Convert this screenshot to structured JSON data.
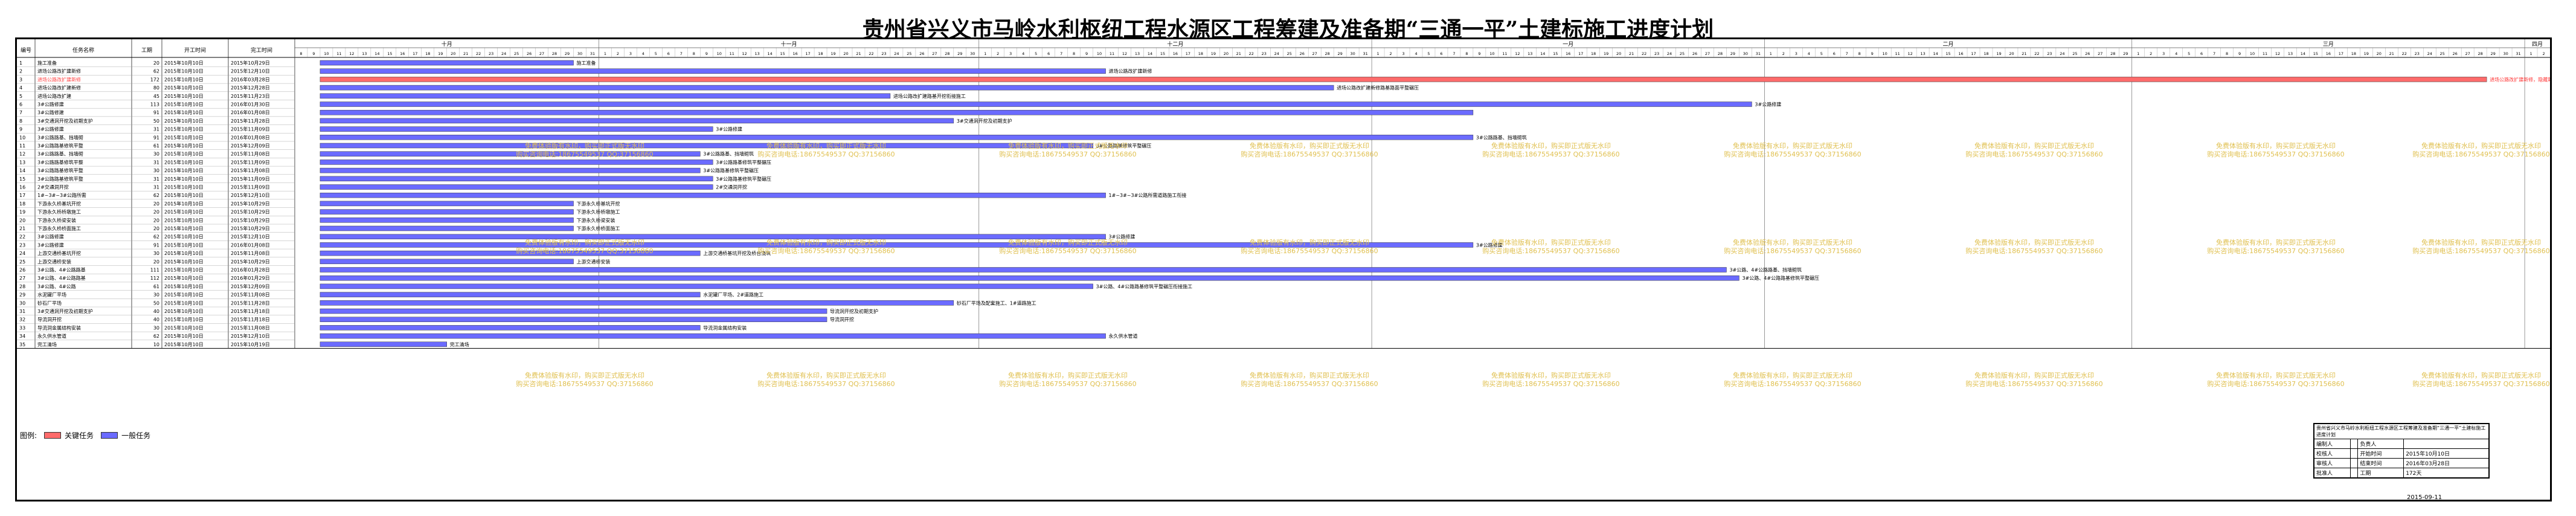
{
  "title": "贵州省兴义市马岭水利枢纽工程水源区工程筹建及准备期“三通一平”土建标施工进度计划",
  "chart_data": {
    "type": "gantt",
    "columns": [
      "编号",
      "任务名称",
      "工期",
      "开工时间",
      "完工时间"
    ],
    "months": [
      "十月",
      "十一月",
      "十二月",
      "一月",
      "二月",
      "三月",
      "四月"
    ],
    "timeline_start": "2015-10-08",
    "timeline_end": "2016-04-02",
    "tasks": [
      {
        "id": "1",
        "name": "施工准备",
        "dur": "20",
        "start": "2015年10月10日",
        "finish": "2015年10月29日",
        "s": "2015-10-10",
        "e": "2015-10-29",
        "label": "施工准备",
        "critical": false
      },
      {
        "id": "2",
        "name": "进场公路改扩建新修",
        "dur": "62",
        "start": "2015年10月10日",
        "finish": "2015年12月10日",
        "s": "2015-10-10",
        "e": "2015-12-10",
        "label": "进场公路改扩建新修",
        "critical": false
      },
      {
        "id": "3",
        "name": "进场公路改扩建新修",
        "dur": "172",
        "start": "2015年10月10日",
        "finish": "2016年03月28日",
        "s": "2015-10-10",
        "e": "2016-03-28",
        "label": "进场公路改扩建新修，隐藏新建",
        "critical": true
      },
      {
        "id": "4",
        "name": "进场公路改扩建新修",
        "dur": "80",
        "start": "2015年10月10日",
        "finish": "2015年12月28日",
        "s": "2015-10-10",
        "e": "2015-12-28",
        "label": "进场公路改扩建新修路基路面平整碾压",
        "critical": false
      },
      {
        "id": "5",
        "name": "进场公路改扩建",
        "dur": "45",
        "start": "2015年10月10日",
        "finish": "2015年11月23日",
        "s": "2015-10-10",
        "e": "2015-11-23",
        "label": "进场公路改扩建路基开挖衔接施工",
        "critical": false
      },
      {
        "id": "6",
        "name": "3#公路修建",
        "dur": "113",
        "start": "2015年10月10日",
        "finish": "2016年01月30日",
        "s": "2015-10-10",
        "e": "2016-01-30",
        "label": "3#公路修建",
        "critical": false
      },
      {
        "id": "7",
        "name": "3#公路修建",
        "dur": "91",
        "start": "2015年10月10日",
        "finish": "2016年01月08日",
        "s": "2015-10-10",
        "e": "2016-01-08",
        "label": "",
        "critical": false
      },
      {
        "id": "8",
        "name": "3#交通洞开挖及初期支护",
        "dur": "50",
        "start": "2015年10月10日",
        "finish": "2015年11月28日",
        "s": "2015-10-10",
        "e": "2015-11-28",
        "label": "3#交通洞开挖及初期支护",
        "critical": false
      },
      {
        "id": "9",
        "name": "3#公路修建",
        "dur": "31",
        "start": "2015年10月10日",
        "finish": "2015年11月09日",
        "s": "2015-10-10",
        "e": "2015-11-09",
        "label": "3#公路修建",
        "critical": false
      },
      {
        "id": "10",
        "name": "3#公路路基、挡墙砌",
        "dur": "91",
        "start": "2015年10月10日",
        "finish": "2016年01月08日",
        "s": "2015-10-10",
        "e": "2016-01-08",
        "label": "3#公路路基、挡墙砌筑",
        "critical": false
      },
      {
        "id": "11",
        "name": "3#公路路基修筑平整",
        "dur": "61",
        "start": "2015年10月10日",
        "finish": "2015年12月09日",
        "s": "2015-10-10",
        "e": "2015-12-09",
        "label": "3#公路路基修筑平整碾压",
        "critical": false
      },
      {
        "id": "12",
        "name": "3#公路路基、挡墙砌",
        "dur": "30",
        "start": "2015年10月10日",
        "finish": "2015年11月08日",
        "s": "2015-10-10",
        "e": "2015-11-08",
        "label": "3#公路路基、挡墙砌筑",
        "critical": false
      },
      {
        "id": "13",
        "name": "3#公路路基修筑平整",
        "dur": "31",
        "start": "2015年10月10日",
        "finish": "2015年11月09日",
        "s": "2015-10-10",
        "e": "2015-11-09",
        "label": "3#公路路基修筑平整碾压",
        "critical": false
      },
      {
        "id": "14",
        "name": "3#公路路基修筑平整",
        "dur": "30",
        "start": "2015年10月10日",
        "finish": "2015年11月08日",
        "s": "2015-10-10",
        "e": "2015-11-08",
        "label": "3#公路路基修筑平整碾压",
        "critical": false
      },
      {
        "id": "15",
        "name": "3#公路路基修筑平整",
        "dur": "31",
        "start": "2015年10月10日",
        "finish": "2015年11月09日",
        "s": "2015-10-10",
        "e": "2015-11-09",
        "label": "3#公路路基修筑平整碾压",
        "critical": false
      },
      {
        "id": "16",
        "name": "2#交通洞开挖",
        "dur": "31",
        "start": "2015年10月10日",
        "finish": "2015年11月09日",
        "s": "2015-10-10",
        "e": "2015-11-09",
        "label": "2#交通洞开挖",
        "critical": false
      },
      {
        "id": "17",
        "name": "1#~3#~3#公路所需",
        "dur": "62",
        "start": "2015年10月10日",
        "finish": "2015年12月10日",
        "s": "2015-10-10",
        "e": "2015-12-10",
        "label": "1#~3#~3#公路所需道路施工衔接",
        "critical": false
      },
      {
        "id": "18",
        "name": "下游永久桥基坑开挖",
        "dur": "20",
        "start": "2015年10月10日",
        "finish": "2015年10月29日",
        "s": "2015-10-10",
        "e": "2015-10-29",
        "label": "下游永久桥基坑开挖",
        "critical": false
      },
      {
        "id": "19",
        "name": "下游永久桥桥墩施工",
        "dur": "20",
        "start": "2015年10月10日",
        "finish": "2015年10月29日",
        "s": "2015-10-10",
        "e": "2015-10-29",
        "label": "下游永久桥桥墩施工",
        "critical": false
      },
      {
        "id": "20",
        "name": "下游永久桥梁安装",
        "dur": "20",
        "start": "2015年10月10日",
        "finish": "2015年10月29日",
        "s": "2015-10-10",
        "e": "2015-10-29",
        "label": "下游永久桥梁安装",
        "critical": false
      },
      {
        "id": "21",
        "name": "下游永久桥桥面施工",
        "dur": "20",
        "start": "2015年10月10日",
        "finish": "2015年10月29日",
        "s": "2015-10-10",
        "e": "2015-10-29",
        "label": "下游永久桥桥面施工",
        "critical": false
      },
      {
        "id": "22",
        "name": "3#公路修建",
        "dur": "62",
        "start": "2015年10月10日",
        "finish": "2015年12月10日",
        "s": "2015-10-10",
        "e": "2015-12-10",
        "label": "3#公路修建",
        "critical": false
      },
      {
        "id": "23",
        "name": "3#公路修建",
        "dur": "91",
        "start": "2015年10月10日",
        "finish": "2016年01月08日",
        "s": "2015-10-10",
        "e": "2016-01-08",
        "label": "3#公路修建",
        "critical": false
      },
      {
        "id": "24",
        "name": "上游交通桥基坑开挖",
        "dur": "30",
        "start": "2015年10月10日",
        "finish": "2015年11月08日",
        "s": "2015-10-10",
        "e": "2015-11-08",
        "label": "上游交通桥基坑开挖及桥台浇筑",
        "critical": false
      },
      {
        "id": "25",
        "name": "上游交通桥安装",
        "dur": "20",
        "start": "2015年10月10日",
        "finish": "2015年10月29日",
        "s": "2015-10-10",
        "e": "2015-10-29",
        "label": "上游交通桥安装",
        "critical": false
      },
      {
        "id": "26",
        "name": "3#公路、4#公路路基",
        "dur": "111",
        "start": "2015年10月10日",
        "finish": "2016年01月28日",
        "s": "2015-10-10",
        "e": "2016-01-28",
        "label": "3#公路、4#公路路基、挡墙砌筑",
        "critical": false
      },
      {
        "id": "27",
        "name": "3#公路、4#公路路基",
        "dur": "112",
        "start": "2015年10月10日",
        "finish": "2016年01月29日",
        "s": "2015-10-10",
        "e": "2016-01-29",
        "label": "3#公路、4#公路路基修筑平整碾压",
        "critical": false
      },
      {
        "id": "28",
        "name": "3#公路、4#公路",
        "dur": "61",
        "start": "2015年10月10日",
        "finish": "2015年12月09日",
        "s": "2015-10-10",
        "e": "2015-12-09",
        "label": "3#公路、4#公路路基修筑平整碾压衔接施工",
        "critical": false
      },
      {
        "id": "29",
        "name": "水泥罐厂平场",
        "dur": "30",
        "start": "2015年10月10日",
        "finish": "2015年11月08日",
        "s": "2015-10-10",
        "e": "2015-11-08",
        "label": "水泥罐厂平场、2#道路施工",
        "critical": false
      },
      {
        "id": "30",
        "name": "砂石厂平场",
        "dur": "50",
        "start": "2015年10月10日",
        "finish": "2015年11月28日",
        "s": "2015-10-10",
        "e": "2015-11-28",
        "label": "砂石厂平场及配套施工、1#道路施工",
        "critical": false
      },
      {
        "id": "31",
        "name": "3#交通洞开挖及初期支护",
        "dur": "40",
        "start": "2015年10月10日",
        "finish": "2015年11月18日",
        "s": "2015-10-10",
        "e": "2015-11-18",
        "label": "导流洞开挖及初期支护",
        "critical": false
      },
      {
        "id": "32",
        "name": "导流洞开挖",
        "dur": "40",
        "start": "2015年10月10日",
        "finish": "2015年11月18日",
        "s": "2015-10-10",
        "e": "2015-11-18",
        "label": "导流洞开挖",
        "critical": false
      },
      {
        "id": "33",
        "name": "导流洞金属结构安装",
        "dur": "30",
        "start": "2015年10月10日",
        "finish": "2015年11月08日",
        "s": "2015-10-10",
        "e": "2015-11-08",
        "label": "导流洞金属结构安装",
        "critical": false
      },
      {
        "id": "34",
        "name": "永久供水管道",
        "dur": "62",
        "start": "2015年10月10日",
        "finish": "2015年12月10日",
        "s": "2015-10-10",
        "e": "2015-12-10",
        "label": "永久供水管道",
        "critical": false
      },
      {
        "id": "35",
        "name": "完工清场",
        "dur": "10",
        "start": "2015年10月10日",
        "finish": "2015年10月19日",
        "s": "2015-10-10",
        "e": "2015-10-19",
        "label": "完工清场",
        "critical": false
      }
    ],
    "critical_color": "#ff6b6b",
    "normal_color": "#6b6bff",
    "watermark_color": "#e0c050",
    "watermark_lines": [
      "免费体验版有水印，购买即正式版无水印",
      "购买咨询电话:18675549537 QQ:37156860"
    ]
  },
  "legend": {
    "label": "图例:",
    "critical": "关键任务",
    "normal": "一般任务"
  },
  "info_block": {
    "company": "贵州省兴义市马岭水利枢纽工程水源区工程筹建及准备期“三通一平”土建标施工进度计划",
    "rows": [
      [
        "编制人",
        "",
        "负责人",
        ""
      ],
      [
        "校核人",
        "",
        "开始时间",
        "2015年10月10日"
      ],
      [
        "审核人",
        "",
        "结束时间",
        "2016年03月28日"
      ],
      [
        "批准人",
        "",
        "工期",
        "172天"
      ]
    ]
  },
  "date_note": "2015-09-11"
}
